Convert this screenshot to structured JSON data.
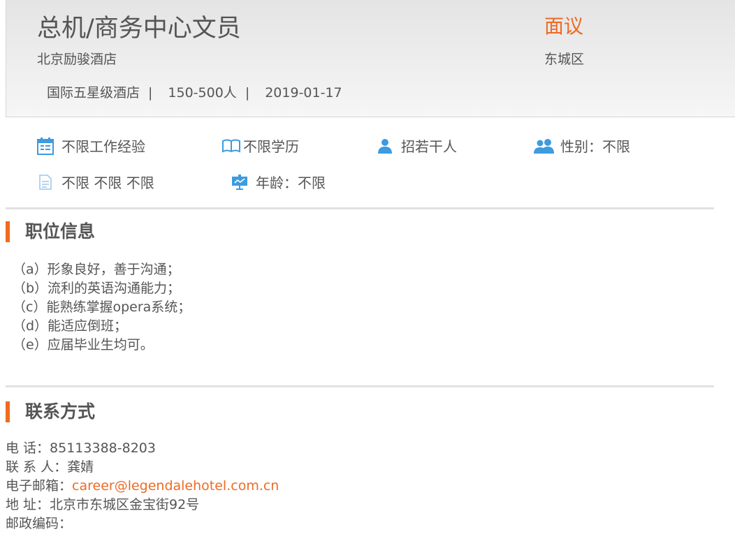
{
  "header": {
    "job_title": "总机/商务中心文员",
    "salary": "面议",
    "company": "北京励骏酒店",
    "district": "东城区",
    "company_type": "国际五星级酒店",
    "company_size": "150-500人",
    "post_date": "2019-01-17",
    "separator": "|"
  },
  "requirements": {
    "experience": "不限工作经验",
    "education": "不限学历",
    "headcount": "招若干人",
    "gender": "性别：不限",
    "other": "不限 不限 不限",
    "age": "年龄：不限"
  },
  "colors": {
    "accent": "#ee6a25",
    "icon_blue": "#3d9be0"
  },
  "icons": [
    "calendar-icon",
    "book-icon",
    "person-icon",
    "people-icon",
    "document-icon",
    "presentation-icon"
  ],
  "position_section": {
    "title": "职位信息",
    "duties": [
      "（a）形象良好，善于沟通；",
      "（b）流利的英语沟通能力；",
      "（c）能熟练掌握opera系统；",
      "（d）能适应倒班；",
      "（e）应届毕业生均可。"
    ]
  },
  "contact_section": {
    "title": "联系方式",
    "phone_label": "电 话：",
    "phone": "85113388-8203",
    "person_label": "联 系 人：",
    "person": "龚婧",
    "email_label": "电子邮箱：",
    "email": "career@legendalehotel.com.cn",
    "address_label": "地 址：",
    "address": "北京市东城区金宝街92号",
    "postcode_label": "邮政编码："
  }
}
